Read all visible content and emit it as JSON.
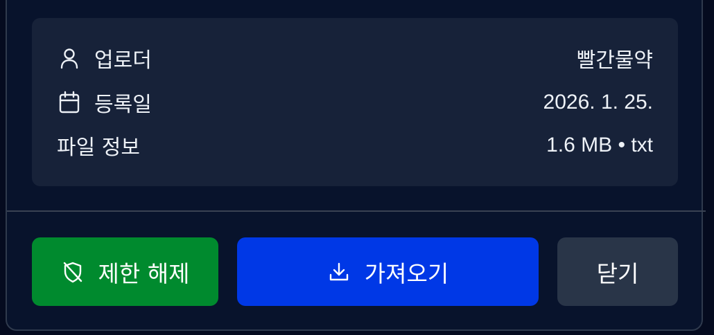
{
  "info": {
    "uploader_label": "업로더",
    "uploader_value": "빨간물약",
    "date_label": "등록일",
    "date_value": "2026. 1. 25.",
    "file_label": "파일 정보",
    "file_value": "1.6 MB • txt"
  },
  "actions": {
    "unrestrict_label": "제한 해제",
    "import_label": "가져오기",
    "close_label": "닫기"
  },
  "icons": {
    "uploader": "user-icon",
    "date": "calendar-icon",
    "unrestrict": "shield-off-icon",
    "import": "download-icon"
  },
  "colors": {
    "background": "#050b1f",
    "card": "#172239",
    "unrestrict_button": "#008a2e",
    "import_button": "#0038e6",
    "close_button": "#293548"
  }
}
